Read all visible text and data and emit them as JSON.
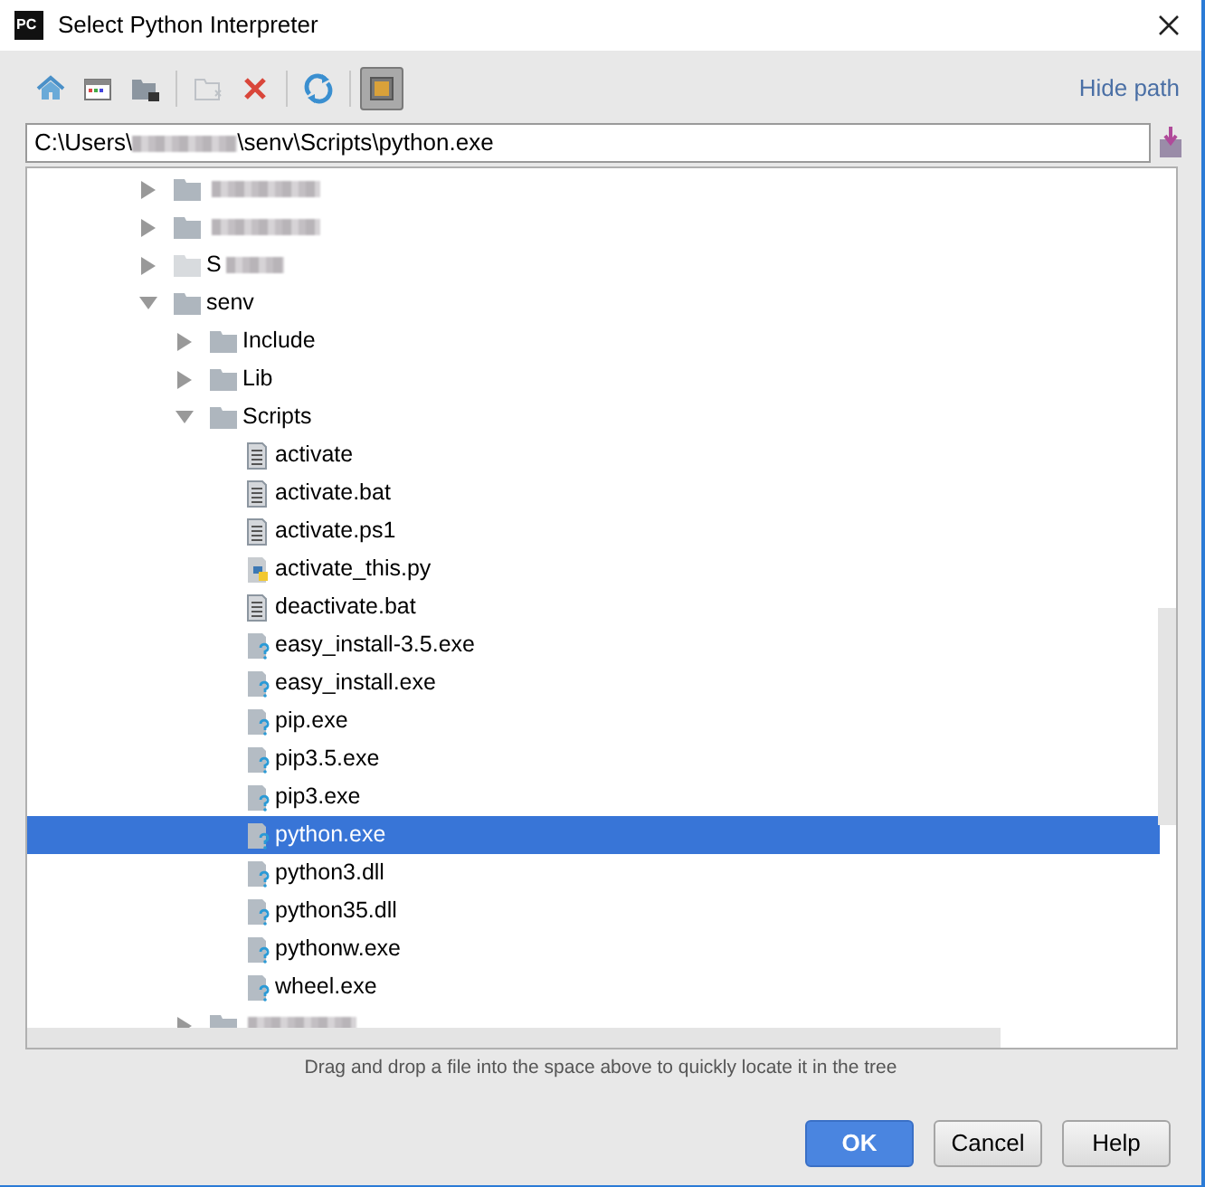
{
  "window": {
    "title": "Select Python Interpreter",
    "app_icon": "PC"
  },
  "toolbar": {
    "buttons": [
      {
        "kind": "home",
        "disabled": false,
        "pressed": false
      },
      {
        "kind": "desktop",
        "disabled": false,
        "pressed": false
      },
      {
        "kind": "project",
        "disabled": false,
        "pressed": false
      },
      {
        "kind": "newfolder",
        "disabled": true,
        "pressed": false
      },
      {
        "kind": "delete",
        "disabled": false,
        "pressed": false
      },
      {
        "kind": "refresh",
        "disabled": false,
        "pressed": false
      },
      {
        "kind": "hidden",
        "disabled": false,
        "pressed": true
      }
    ],
    "hide_path": "Hide path"
  },
  "path": {
    "prefix": "C:\\Users\\",
    "redacted": true,
    "suffix": "\\senv\\Scripts\\python.exe"
  },
  "tree": [
    {
      "kind": "folder",
      "redacted": true,
      "expanded": false,
      "selected": false
    },
    {
      "kind": "folder",
      "redacted": true,
      "expanded": false,
      "selected": false
    },
    {
      "kind": "folder",
      "label": "S",
      "redacted": true,
      "faded": true,
      "expanded": false,
      "selected": false
    },
    {
      "kind": "folder",
      "label": "senv",
      "expanded": true,
      "selected": false,
      "children": [
        {
          "kind": "folder",
          "label": "Include",
          "expanded": false,
          "selected": false
        },
        {
          "kind": "folder",
          "label": "Lib",
          "expanded": false,
          "selected": false
        },
        {
          "kind": "folder",
          "label": "Scripts",
          "expanded": true,
          "selected": false,
          "children": [
            {
              "kind": "text",
              "label": "activate",
              "selected": false
            },
            {
              "kind": "text",
              "label": "activate.bat",
              "selected": false
            },
            {
              "kind": "text",
              "label": "activate.ps1",
              "selected": false
            },
            {
              "kind": "python",
              "label": "activate_this.py",
              "selected": false
            },
            {
              "kind": "text",
              "label": "deactivate.bat",
              "selected": false
            },
            {
              "kind": "exe",
              "label": "easy_install-3.5.exe",
              "selected": false
            },
            {
              "kind": "exe",
              "label": "easy_install.exe",
              "selected": false
            },
            {
              "kind": "exe",
              "label": "pip.exe",
              "selected": false
            },
            {
              "kind": "exe",
              "label": "pip3.5.exe",
              "selected": false
            },
            {
              "kind": "exe",
              "label": "pip3.exe",
              "selected": false
            },
            {
              "kind": "exe",
              "label": "python.exe",
              "selected": true
            },
            {
              "kind": "exe",
              "label": "python3.dll",
              "selected": false
            },
            {
              "kind": "exe",
              "label": "python35.dll",
              "selected": false
            },
            {
              "kind": "exe",
              "label": "pythonw.exe",
              "selected": false
            },
            {
              "kind": "exe",
              "label": "wheel.exe",
              "selected": false
            }
          ]
        },
        {
          "kind": "folder",
          "redacted": true,
          "expanded": false,
          "selected": false
        }
      ]
    }
  ],
  "hint": "Drag and drop a file into the space above to quickly locate it in the tree",
  "buttons": [
    {
      "label": "OK",
      "default": true
    },
    {
      "label": "Cancel",
      "default": false
    },
    {
      "label": "Help",
      "default": false
    }
  ]
}
